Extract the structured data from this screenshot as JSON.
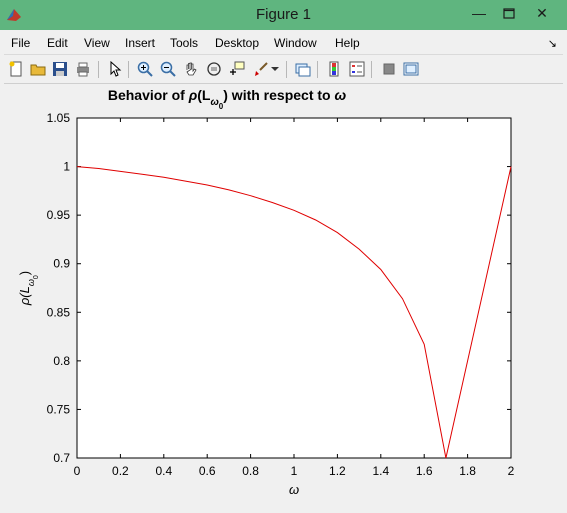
{
  "window": {
    "title": "Figure 1",
    "close_label": "✕",
    "minimize_label": "—"
  },
  "menu": [
    "File",
    "Edit",
    "View",
    "Insert",
    "Tools",
    "Desktop",
    "Window",
    "Help"
  ],
  "menu_arrow": "↘",
  "toolbar_icons": [
    "new-figure-icon",
    "open-file-icon",
    "save-icon",
    "print-icon",
    "pointer-icon",
    "zoom-in-icon",
    "zoom-out-icon",
    "pan-icon",
    "rotate-3d-icon",
    "data-cursor-icon",
    "brush-icon",
    "brush-dropdown-icon",
    "link-plot-icon",
    "colorbar-icon",
    "legend-icon",
    "hide-plot-tools-icon",
    "show-plot-tools-icon"
  ],
  "colors": {
    "titlebar": "#5fb57f",
    "line": "#e00000",
    "axes_bg": "#ffffff"
  },
  "chart_data": {
    "type": "line",
    "title_prefix": "Behavior of ",
    "title_rho": "ρ",
    "title_mid": "(L",
    "title_sub": "ω",
    "title_subsub": "0",
    "title_suffix": ") with respect to ",
    "title_omega": "ω",
    "xlabel": "ω",
    "ylabel_main": "ρ(L",
    "ylabel_sub": "ω",
    "ylabel_subsub": "0",
    "ylabel_close": ")",
    "xlim": [
      0,
      2
    ],
    "ylim": [
      0.7,
      1.05
    ],
    "xticks": [
      "0",
      "0.2",
      "0.4",
      "0.6",
      "0.8",
      "1",
      "1.2",
      "1.4",
      "1.6",
      "1.8",
      "2"
    ],
    "yticks": [
      "0.7",
      "0.75",
      "0.8",
      "0.85",
      "0.9",
      "0.95",
      "1",
      "1.05"
    ],
    "grid": false,
    "series": [
      {
        "color": "#e00000",
        "x": [
          0,
          0.1,
          0.2,
          0.3,
          0.4,
          0.5,
          0.6,
          0.7,
          0.8,
          0.9,
          1.0,
          1.1,
          1.2,
          1.3,
          1.4,
          1.5,
          1.6,
          1.7,
          2.0
        ],
        "y": [
          1.0,
          0.998,
          0.995,
          0.992,
          0.989,
          0.985,
          0.981,
          0.976,
          0.97,
          0.963,
          0.955,
          0.945,
          0.932,
          0.915,
          0.894,
          0.864,
          0.817,
          0.7,
          1.0
        ]
      }
    ]
  }
}
